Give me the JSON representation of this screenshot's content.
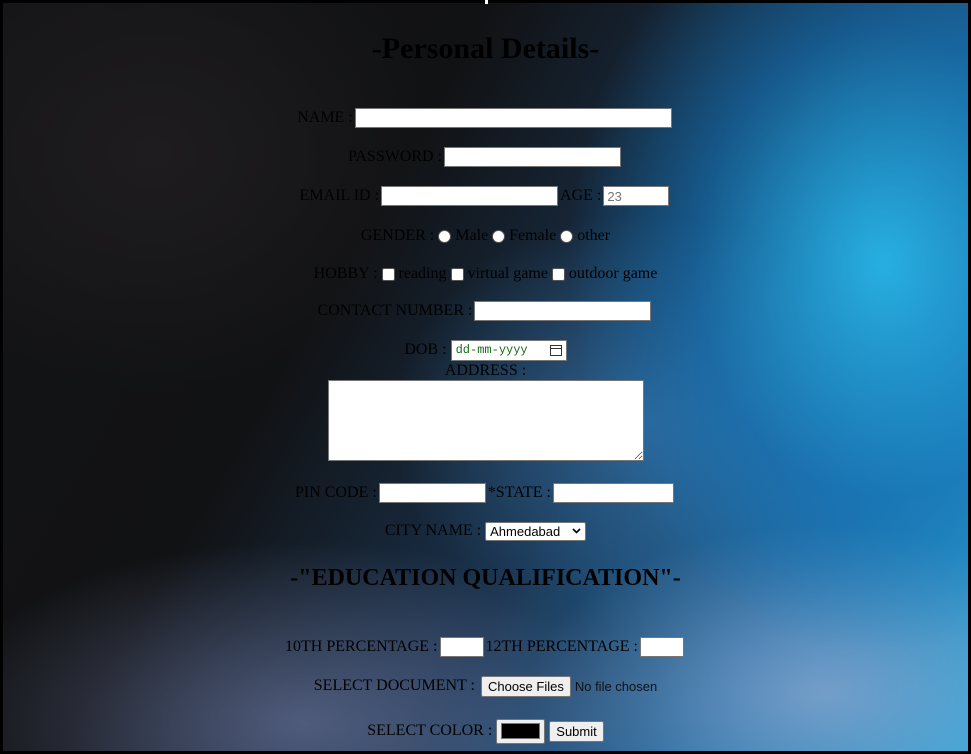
{
  "form": {
    "title": "-Personal Details-",
    "name_label": "NAME :",
    "name_value": "",
    "password_label": "PASSWORD :",
    "password_value": "",
    "email_label": "EMAIL ID :",
    "email_value": "",
    "age_label": "AGE :",
    "age_placeholder": "23",
    "gender_label": "GENDER :",
    "gender_options": [
      "Male",
      "Female",
      "other"
    ],
    "hobby_label": "HOBBY :",
    "hobby_options": [
      "reading",
      "virtual game",
      "outdoor game"
    ],
    "contact_label": "CONTACT NUMBER :",
    "contact_value": "",
    "dob_label": "DOB :",
    "dob_placeholder": "dd-mm-yyyy",
    "address_label": "ADDRESS :",
    "address_value": "",
    "pin_label": "PIN CODE :",
    "pin_value": "",
    "state_label": "*STATE :",
    "state_value": "",
    "city_label": "CITY NAME :",
    "city_selected": "Ahmedabad"
  },
  "education": {
    "title": "-\"EDUCATION QUALIFICATION\"-",
    "tenth_label": "10TH PERCENTAGE :",
    "twelfth_label": "12TH PERCENTAGE :",
    "document_label": "SELECT DOCUMENT :",
    "choose_files_label": "Choose Files",
    "no_file_text": "No file chosen",
    "color_label": "SELECT COLOR :",
    "color_value": "#000000",
    "submit_label": "Submit"
  }
}
